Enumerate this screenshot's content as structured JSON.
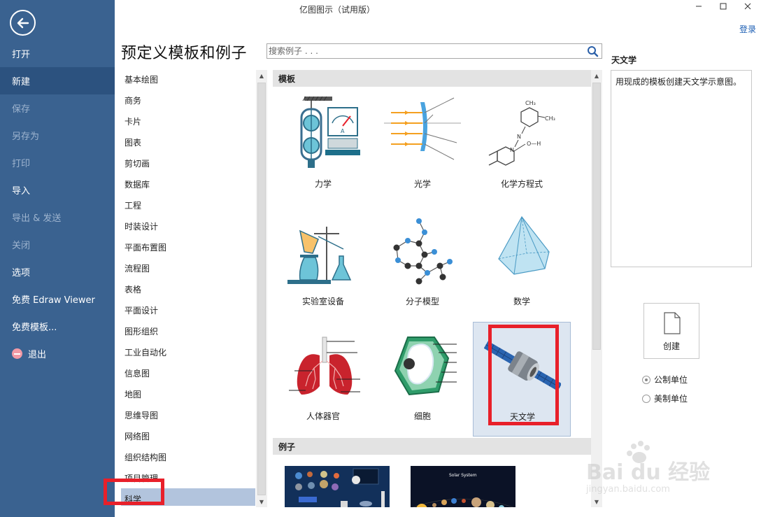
{
  "window": {
    "title": "亿图图示（试用版）",
    "login": "登录"
  },
  "nav": {
    "items": [
      {
        "label": "打开",
        "state": "normal"
      },
      {
        "label": "新建",
        "state": "active"
      },
      {
        "label": "保存",
        "state": "disabled"
      },
      {
        "label": "另存为",
        "state": "disabled"
      },
      {
        "label": "打印",
        "state": "disabled"
      },
      {
        "label": "导入",
        "state": "normal"
      },
      {
        "label": "导出 & 发送",
        "state": "disabled"
      },
      {
        "label": "关闭",
        "state": "disabled"
      },
      {
        "label": "选项",
        "state": "normal"
      },
      {
        "label": "免费 Edraw Viewer",
        "state": "normal"
      },
      {
        "label": "免费模板...",
        "state": "normal"
      },
      {
        "label": "退出",
        "state": "normal"
      }
    ]
  },
  "main": {
    "heading": "预定义模板和例子",
    "search_placeholder": "搜索例子 . . ."
  },
  "categories": [
    "基本绘图",
    "商务",
    "卡片",
    "图表",
    "剪切画",
    "数据库",
    "工程",
    "时装设计",
    "平面布置图",
    "流程图",
    "表格",
    "平面设计",
    "图形组织",
    "工业自动化",
    "信息图",
    "地图",
    "思维导图",
    "网络图",
    "组织结构图",
    "项目管理",
    "科学"
  ],
  "selected_category": "科学",
  "templates": {
    "section_label": "模板",
    "items": [
      "力学",
      "光学",
      "化学方程式",
      "实验室设备",
      "分子模型",
      "数学",
      "人体器官",
      "细胞",
      "天文学"
    ],
    "selected": "天文学"
  },
  "examples": {
    "section_label": "例子",
    "items": [
      {
        "caption": ""
      },
      {
        "caption": "Solar System"
      }
    ]
  },
  "detail": {
    "title": "天文学",
    "description": "用现成的模板创建天文学示意图。",
    "create_label": "创建",
    "unit_metric": "公制单位",
    "unit_us": "美制单位",
    "selected_unit": "公制单位"
  },
  "watermark": {
    "brand": "Bai du 经验",
    "url": "jingyan.baidu.com"
  },
  "colors": {
    "nav_bg": "#3a6290",
    "accent_red": "#e8202a",
    "selection": "#b2c4dd"
  }
}
